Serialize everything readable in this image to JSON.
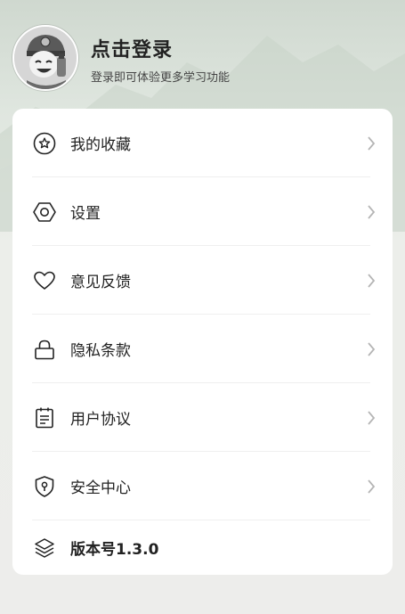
{
  "header": {
    "title": "点击登录",
    "subtitle": "登录即可体验更多学习功能"
  },
  "menu": [
    {
      "label": "我的收藏",
      "icon": "star-circle-icon"
    },
    {
      "label": "设置",
      "icon": "hexagon-settings-icon"
    },
    {
      "label": "意见反馈",
      "icon": "heart-icon"
    },
    {
      "label": "隐私条款",
      "icon": "lock-icon"
    },
    {
      "label": "用户协议",
      "icon": "document-icon"
    },
    {
      "label": "安全中心",
      "icon": "shield-icon"
    }
  ],
  "version": {
    "label": "版本号1.3.0",
    "icon": "layers-icon"
  }
}
